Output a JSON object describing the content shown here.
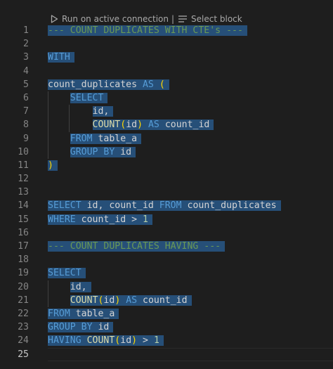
{
  "codelens": {
    "run_label": "Run on active connection",
    "separator": "|",
    "select_label": "Select block"
  },
  "colors": {
    "background": "#1e1e1e",
    "selection": "#264f78",
    "comment": "#6a9955",
    "keyword": "#569cd6",
    "function": "#dcdcaa",
    "bracket": "#ffd700",
    "identifier": "#d4d4d4",
    "number": "#b5cea8",
    "line_number": "#858585"
  },
  "editor": {
    "active_line": 25,
    "lines": [
      {
        "n": "1",
        "indent": 0,
        "tokens": [
          {
            "t": "--- COUNT DUPLICATES WITH CTE's ---",
            "c": "comment"
          }
        ]
      },
      {
        "n": "2",
        "indent": 0,
        "tokens": []
      },
      {
        "n": "3",
        "indent": 0,
        "tokens": [
          {
            "t": "WITH",
            "c": "keyword"
          }
        ]
      },
      {
        "n": "4",
        "indent": 0,
        "tokens": []
      },
      {
        "n": "5",
        "indent": 0,
        "tokens": [
          {
            "t": "count_duplicates ",
            "c": "ident"
          },
          {
            "t": "AS",
            "c": "keyword"
          },
          {
            "t": " ",
            "c": "ident"
          },
          {
            "t": "(",
            "c": "punct"
          }
        ]
      },
      {
        "n": "6",
        "indent": 1,
        "tokens": [
          {
            "t": "SELECT",
            "c": "keyword"
          }
        ]
      },
      {
        "n": "7",
        "indent": 2,
        "tokens": [
          {
            "t": "id,",
            "c": "ident"
          }
        ]
      },
      {
        "n": "8",
        "indent": 2,
        "tokens": [
          {
            "t": "COUNT",
            "c": "func"
          },
          {
            "t": "(",
            "c": "punct"
          },
          {
            "t": "id",
            "c": "ident"
          },
          {
            "t": ")",
            "c": "punct"
          },
          {
            "t": " ",
            "c": "ident"
          },
          {
            "t": "AS",
            "c": "keyword"
          },
          {
            "t": " count_id",
            "c": "ident"
          }
        ]
      },
      {
        "n": "9",
        "indent": 1,
        "tokens": [
          {
            "t": "FROM",
            "c": "keyword"
          },
          {
            "t": " table_a",
            "c": "ident"
          }
        ]
      },
      {
        "n": "10",
        "indent": 1,
        "tokens": [
          {
            "t": "GROUP BY",
            "c": "keyword"
          },
          {
            "t": " id",
            "c": "ident"
          }
        ]
      },
      {
        "n": "11",
        "indent": 0,
        "tokens": [
          {
            "t": ")",
            "c": "punct"
          }
        ]
      },
      {
        "n": "12",
        "indent": 0,
        "tokens": []
      },
      {
        "n": "13",
        "indent": 0,
        "tokens": []
      },
      {
        "n": "14",
        "indent": 0,
        "tokens": [
          {
            "t": "SELECT",
            "c": "keyword"
          },
          {
            "t": " id, count_id ",
            "c": "ident"
          },
          {
            "t": "FROM",
            "c": "keyword"
          },
          {
            "t": " count_duplicates",
            "c": "ident"
          }
        ]
      },
      {
        "n": "15",
        "indent": 0,
        "tokens": [
          {
            "t": "WHERE",
            "c": "keyword"
          },
          {
            "t": " count_id ",
            "c": "ident"
          },
          {
            "t": ">",
            "c": "op"
          },
          {
            "t": " ",
            "c": "ident"
          },
          {
            "t": "1",
            "c": "num"
          }
        ]
      },
      {
        "n": "16",
        "indent": 0,
        "tokens": []
      },
      {
        "n": "17",
        "indent": 0,
        "tokens": [
          {
            "t": "--- COUNT DUPLICATES HAVING ---",
            "c": "comment"
          }
        ]
      },
      {
        "n": "18",
        "indent": 0,
        "tokens": []
      },
      {
        "n": "19",
        "indent": 0,
        "tokens": [
          {
            "t": "SELECT",
            "c": "keyword"
          }
        ]
      },
      {
        "n": "20",
        "indent": 1,
        "tokens": [
          {
            "t": "id,",
            "c": "ident"
          }
        ]
      },
      {
        "n": "21",
        "indent": 1,
        "tokens": [
          {
            "t": "COUNT",
            "c": "func"
          },
          {
            "t": "(",
            "c": "punct"
          },
          {
            "t": "id",
            "c": "ident"
          },
          {
            "t": ")",
            "c": "punct"
          },
          {
            "t": " ",
            "c": "ident"
          },
          {
            "t": "AS",
            "c": "keyword"
          },
          {
            "t": " count_id",
            "c": "ident"
          }
        ]
      },
      {
        "n": "22",
        "indent": 0,
        "tokens": [
          {
            "t": "FROM",
            "c": "keyword"
          },
          {
            "t": " table_a",
            "c": "ident"
          }
        ]
      },
      {
        "n": "23",
        "indent": 0,
        "tokens": [
          {
            "t": "GROUP BY",
            "c": "keyword"
          },
          {
            "t": " id",
            "c": "ident"
          }
        ]
      },
      {
        "n": "24",
        "indent": 0,
        "tokens": [
          {
            "t": "HAVING",
            "c": "keyword"
          },
          {
            "t": " ",
            "c": "ident"
          },
          {
            "t": "COUNT",
            "c": "func"
          },
          {
            "t": "(",
            "c": "punct"
          },
          {
            "t": "id",
            "c": "ident"
          },
          {
            "t": ")",
            "c": "punct"
          },
          {
            "t": " ",
            "c": "ident"
          },
          {
            "t": ">",
            "c": "op"
          },
          {
            "t": " ",
            "c": "ident"
          },
          {
            "t": "1",
            "c": "num"
          }
        ]
      },
      {
        "n": "25",
        "indent": 0,
        "tokens": []
      }
    ],
    "selected_lines": [
      1,
      3,
      5,
      6,
      7,
      8,
      9,
      10,
      11,
      14,
      15,
      17,
      19,
      20,
      21,
      22,
      23,
      24
    ]
  }
}
